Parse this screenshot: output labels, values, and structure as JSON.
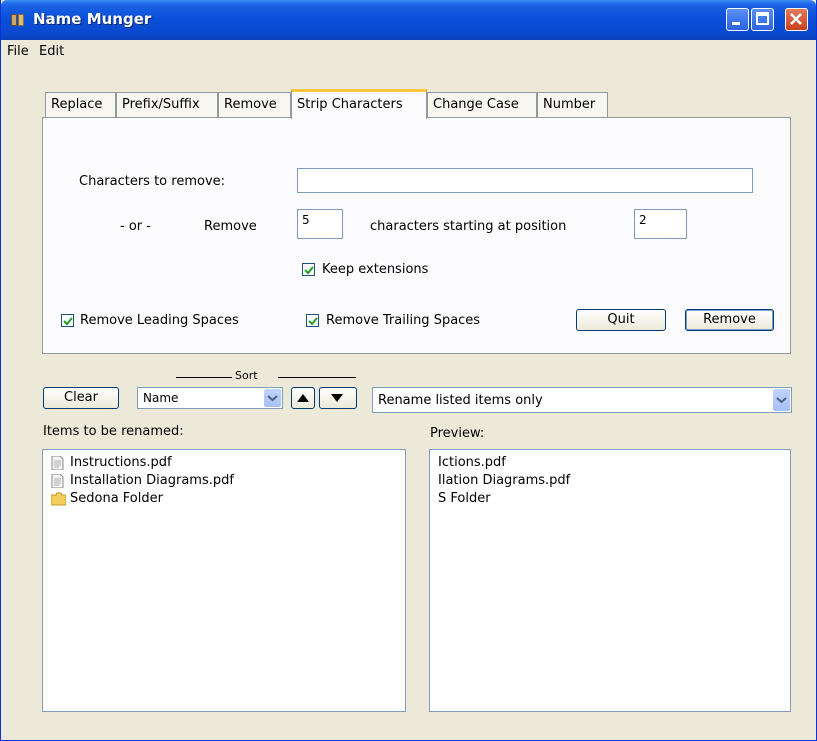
{
  "window": {
    "title": "Name Munger"
  },
  "menu": {
    "items": [
      "File",
      "Edit"
    ]
  },
  "tabs": [
    "Replace",
    "Prefix/Suffix",
    "Remove",
    "Strip Characters",
    "Change Case",
    "Number"
  ],
  "active_tab": "Strip Characters",
  "strip": {
    "chars_label": "Characters to remove:",
    "chars_value": "",
    "or_label": "- or -",
    "remove_label": "Remove",
    "count_value": "5",
    "starting_label": "characters starting at position",
    "position_value": "2",
    "keep_ext_label": "Keep extensions",
    "keep_ext_checked": true,
    "leading_label": "Remove Leading Spaces",
    "leading_checked": true,
    "trailing_label": "Remove Trailing Spaces",
    "trailing_checked": true,
    "quit_label": "Quit",
    "remove_button_label": "Remove"
  },
  "controls": {
    "clear_label": "Clear",
    "sort_label": "Sort",
    "sort_value": "Name",
    "rename_mode_value": "Rename listed items only"
  },
  "items_panel": {
    "label": "Items to be renamed:",
    "items": [
      {
        "name": "Instructions.pdf",
        "icon": "pdf-file-icon"
      },
      {
        "name": "Installation Diagrams.pdf",
        "icon": "pdf-file-icon"
      },
      {
        "name": "Sedona Folder",
        "icon": "folder-icon"
      }
    ]
  },
  "preview_panel": {
    "label": "Preview:",
    "items": [
      "Ictions.pdf",
      "Ilation Diagrams.pdf",
      "S Folder"
    ]
  },
  "colors": {
    "titlebar": "#0a4fd9",
    "window_bg": "#ece9d8",
    "active_tab_accent": "#ffc83c",
    "check": "#21a121"
  }
}
